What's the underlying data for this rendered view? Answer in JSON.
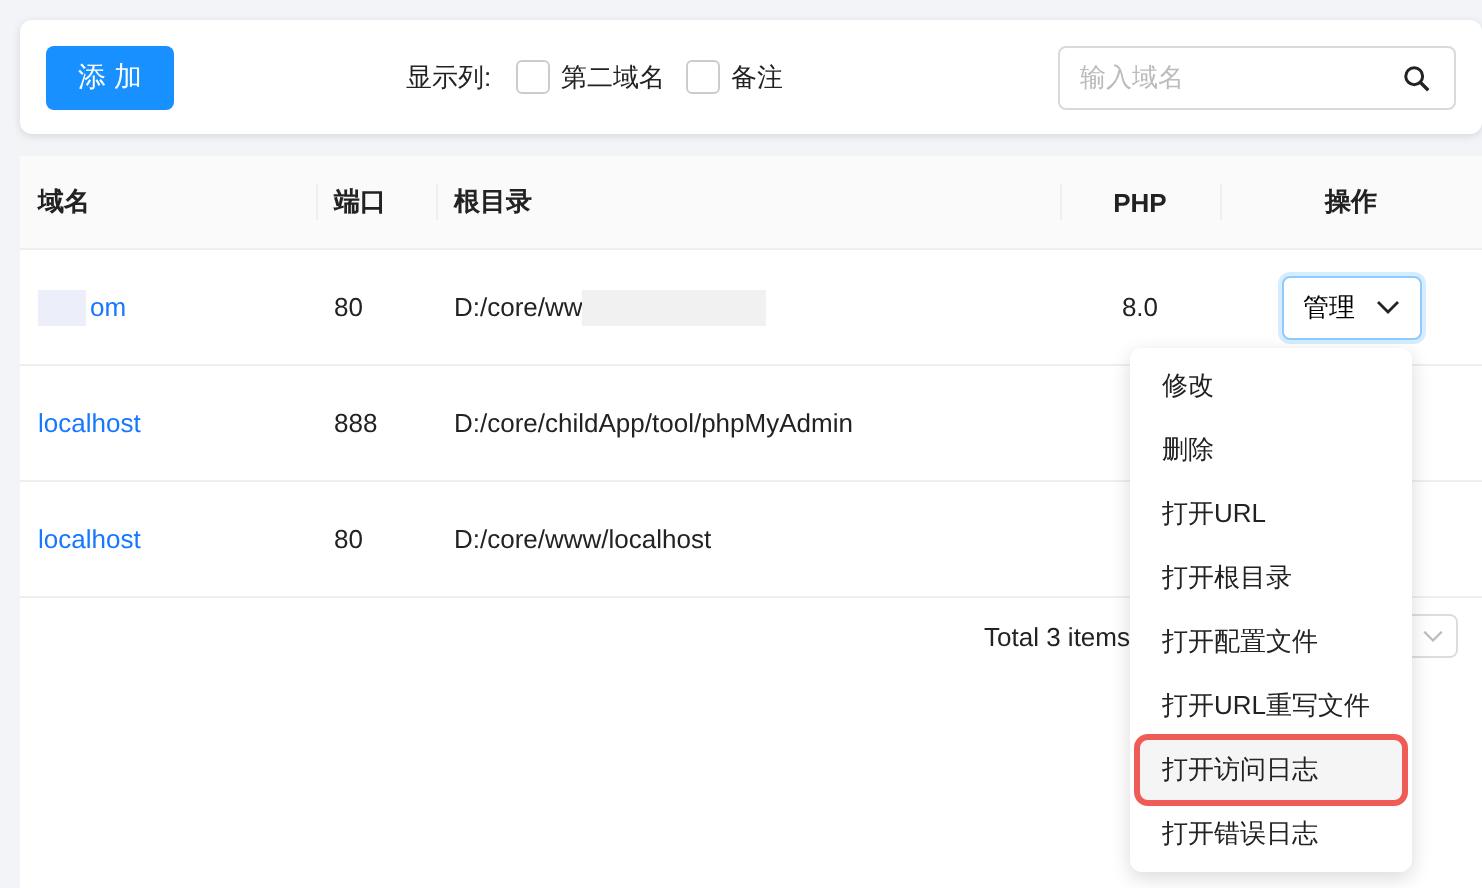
{
  "toolbar": {
    "add_button": "添 加",
    "show_columns_label": "显示列:",
    "column_toggles": [
      {
        "label": "第二域名",
        "checked": false
      },
      {
        "label": "备注",
        "checked": false
      }
    ],
    "search": {
      "placeholder": "输入域名"
    }
  },
  "table": {
    "columns": [
      "域名",
      "端口",
      "根目录",
      "PHP",
      "操作"
    ],
    "rows": [
      {
        "domain": "om",
        "redacted": true,
        "port": "80",
        "root": "D:/core/ww",
        "php": "8.0",
        "action": "管理"
      },
      {
        "domain": "localhost",
        "redacted": false,
        "port": "888",
        "root": "D:/core/childApp/tool/phpMyAdmin",
        "action": null
      },
      {
        "domain": "localhost",
        "redacted": false,
        "port": "80",
        "root": "D:/core/www/localhost",
        "action": null
      }
    ]
  },
  "pagination": {
    "total": "Total 3 items"
  },
  "menu": {
    "items": [
      {
        "label": "修改",
        "hovered": false
      },
      {
        "label": "删除",
        "hovered": false
      },
      {
        "label": "打开URL",
        "hovered": false
      },
      {
        "label": "打开根目录",
        "hovered": false
      },
      {
        "label": "打开配置文件",
        "hovered": false
      },
      {
        "label": "打开URL重写文件",
        "hovered": false
      },
      {
        "label": "打开访问日志",
        "hovered": true
      },
      {
        "label": "打开错误日志",
        "hovered": false
      }
    ]
  }
}
